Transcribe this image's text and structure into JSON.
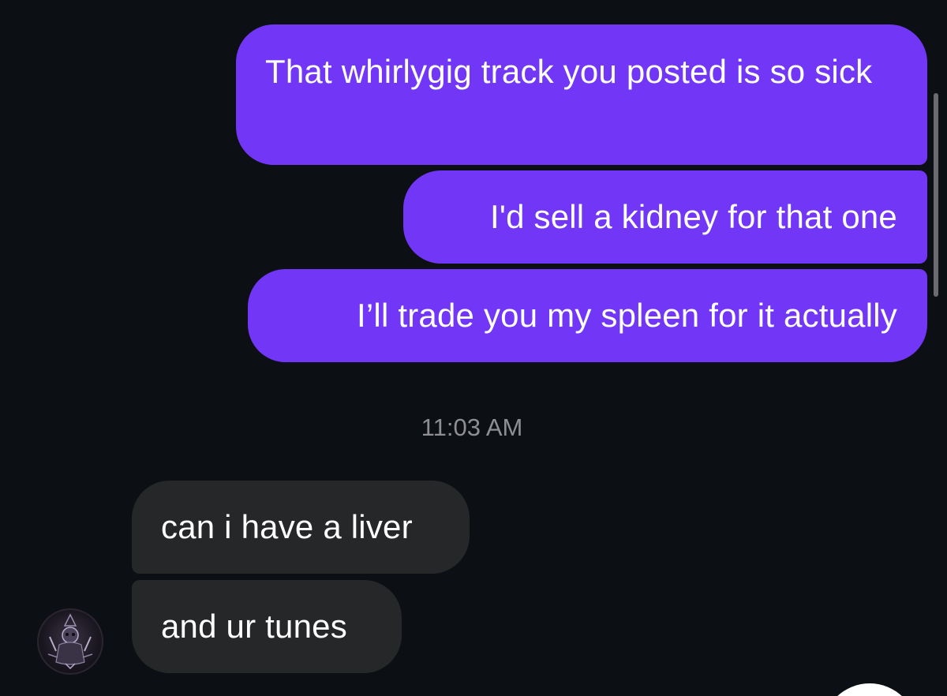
{
  "conversation": {
    "outgoing": [
      {
        "text": "That whirlygig track you posted is so sick"
      },
      {
        "text": "I'd sell a kidney for that one"
      },
      {
        "text": "I’ll trade you my spleen for it actually"
      }
    ],
    "timestamp": "11:03 AM",
    "incoming": [
      {
        "text": "can i have a liver"
      },
      {
        "text": "and ur tunes"
      }
    ]
  },
  "colors": {
    "background": "#0c1014",
    "outgoing_bubble": "#7237f6",
    "incoming_bubble": "#262729",
    "timestamp_text": "#8e8e93"
  },
  "icons": {
    "avatar": "sender-avatar-icon"
  }
}
